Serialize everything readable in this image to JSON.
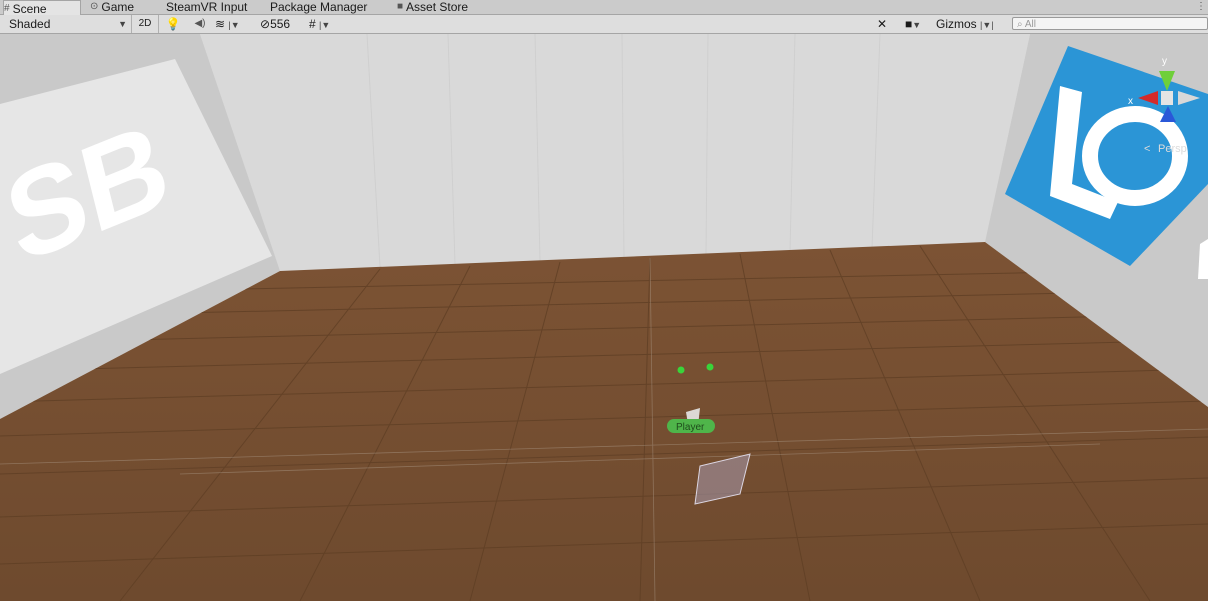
{
  "tabs": [
    {
      "label": "Scene",
      "icon": "scene-grid-icon",
      "active": true
    },
    {
      "label": "Game",
      "icon": "gamepad-icon"
    },
    {
      "label": "SteamVR Input"
    },
    {
      "label": "Package Manager"
    },
    {
      "label": "Asset Store",
      "icon": "shopping-bag-icon"
    }
  ],
  "toolbar": {
    "shading_mode": "Shaded",
    "mode_2d": "2D",
    "hidden_count": "556",
    "gizmos_label": "Gizmos",
    "search_placeholder": "All"
  },
  "scene": {
    "left_wall_text": "SB",
    "player_label": "Player",
    "gizmo_axes": {
      "x": "x",
      "y": "y",
      "z": "z"
    },
    "projection_label": "Persp",
    "colors": {
      "floor": "#7a5232",
      "wall": "#d6d6d6",
      "logo_blue": "#2b95d6"
    }
  }
}
